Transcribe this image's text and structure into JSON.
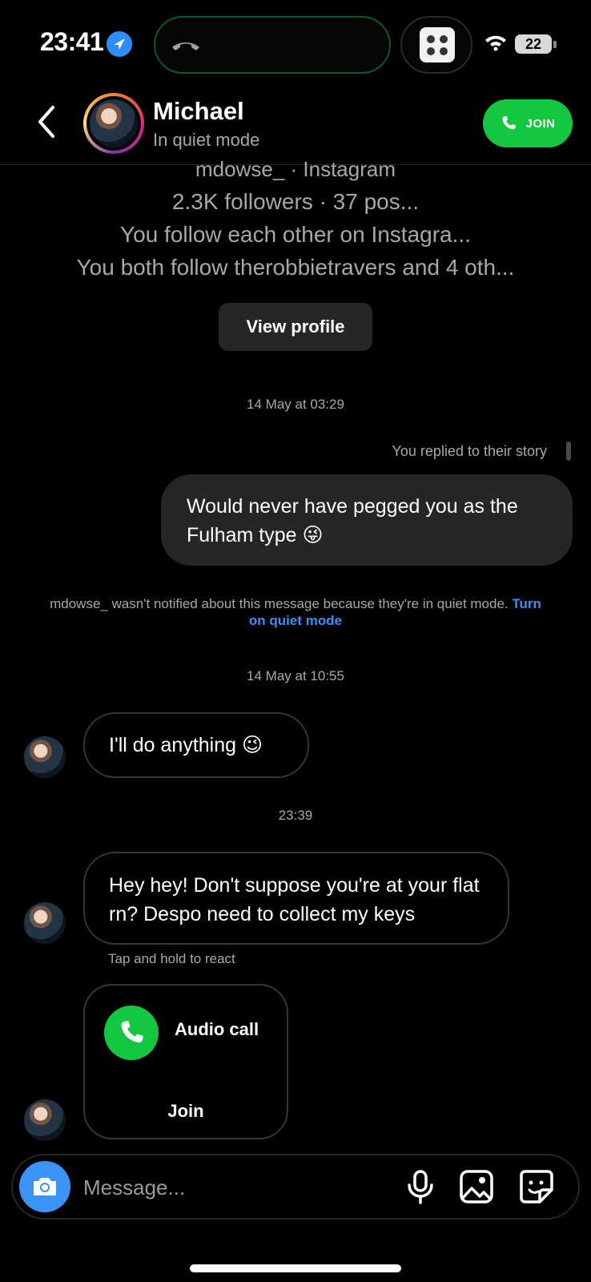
{
  "status_bar": {
    "time": "23:41",
    "battery": "22"
  },
  "header": {
    "name": "Michael",
    "status": "In quiet mode",
    "join_label": "JOIN",
    "accent": "#13c741"
  },
  "profile": {
    "handle_line": "mdowse_ · Instagram",
    "stats": "2.3K followers · 37 pos...",
    "mutual": "You follow each other on Instagra...",
    "also_follow": "You both follow therobbietravers and 4 oth...",
    "view_profile": "View profile"
  },
  "messages": {
    "ts1": "14 May at 03:29",
    "reply_note": "You replied to their story",
    "sent_text": "Would never have pegged you as the Fulham type 😜",
    "quiet_note": "mdowse_ wasn't notified about this message because they're in quiet mode.",
    "quiet_link": "Turn on quiet mode",
    "ts2": "14 May at 10:55",
    "recv1": "I'll do anything 😉",
    "ts3": "23:39",
    "recv2": "Hey hey! Don't suppose you're at your flat rn? Despo need to collect my keys",
    "react_hint": "Tap and hold to react",
    "call_label": "Audio call",
    "call_join": "Join"
  },
  "composer": {
    "placeholder": "Message..."
  },
  "colors": {
    "link": "#3d8ef6",
    "camera": "#3b93f6",
    "sent_bubble": "#262626"
  }
}
